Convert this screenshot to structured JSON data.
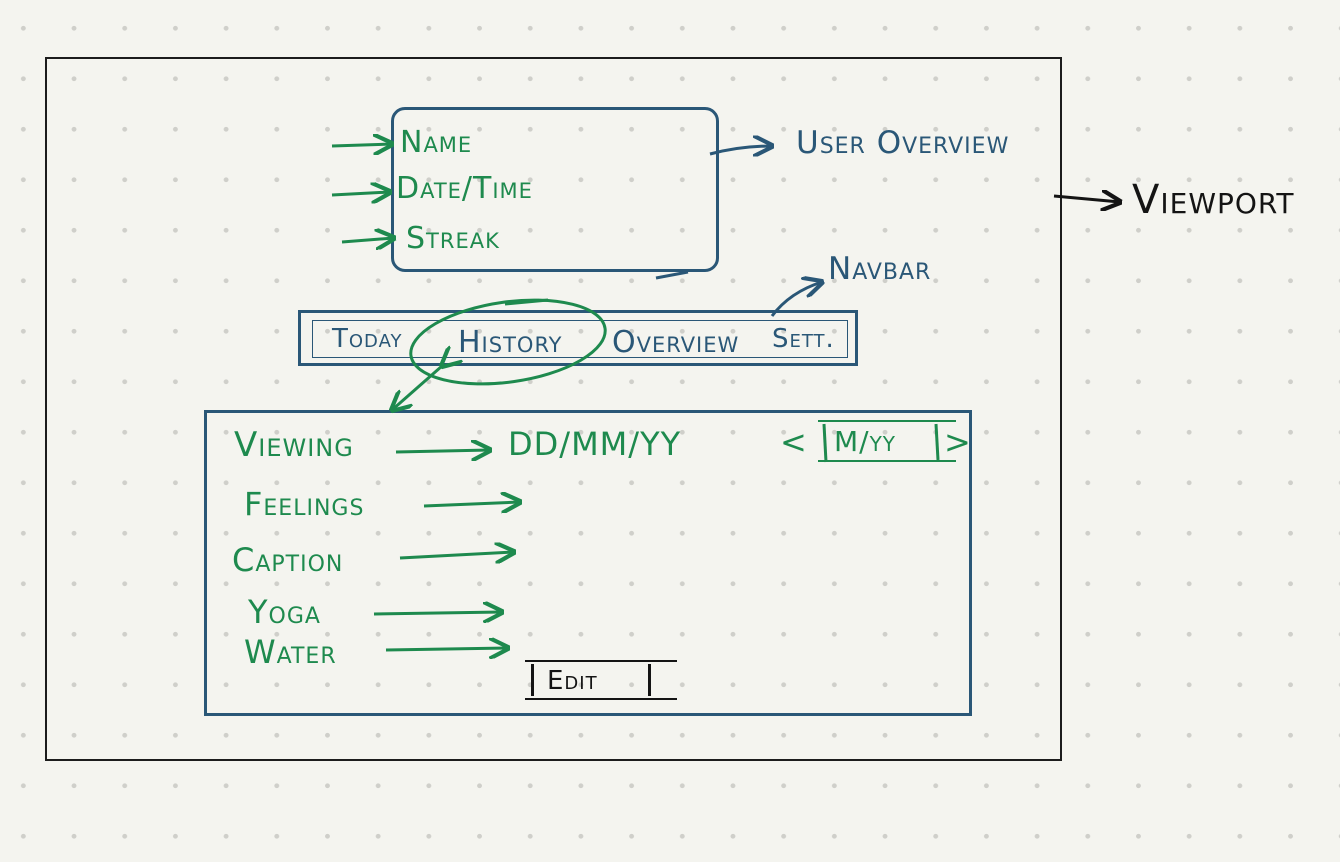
{
  "viewport": {
    "label": "Viewport"
  },
  "user_overview": {
    "label": "User Overview",
    "fields": [
      "Name",
      "Date/Time",
      "Streak"
    ]
  },
  "navbar": {
    "label": "Navbar",
    "tabs": [
      "Today",
      "History",
      "Overview",
      "Sett."
    ],
    "active_tab": "History"
  },
  "history_panel": {
    "viewing_label": "Viewing",
    "date_format": "DD/MM/YY",
    "month_picker": {
      "prev": "<",
      "value": "M/yy",
      "next": ">"
    },
    "fields": [
      "Feelings",
      "Caption",
      "Yoga",
      "Water"
    ],
    "edit_label": "Edit"
  },
  "colors": {
    "structure": "#2a5777",
    "annotation": "#1e8a4e",
    "ink": "#141414",
    "paper": "#f4f4ef"
  }
}
